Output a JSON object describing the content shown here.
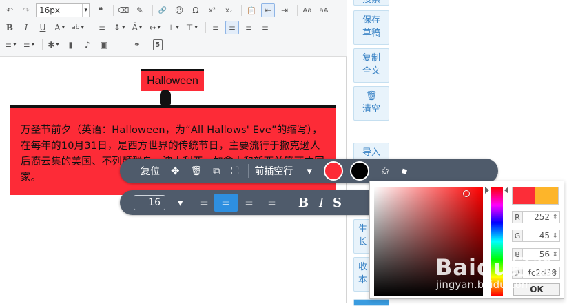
{
  "toolbar": {
    "font_size": "16px",
    "row1_icons": [
      "undo-icon",
      "redo-icon"
    ],
    "row1_after": [
      "quote-icon",
      "eraser-icon",
      "brush-icon",
      "link-icon",
      "emoji-icon",
      "omega-icon",
      "superscript-icon",
      "subscript-icon",
      "paste-icon",
      "indent-left-icon",
      "indent-right-icon",
      "font-up-icon",
      "font-down-icon"
    ],
    "glyphs": {
      "undo": "↶",
      "redo": "↷",
      "quote": "❝",
      "eraser": "⌫",
      "brush": "✎",
      "link": "🔗",
      "emoji": "☺",
      "omega": "Ω",
      "sup": "x²",
      "sub": "x₂",
      "paste": "📋",
      "indl": "⇤",
      "indr": "⇥",
      "fup": "Aa",
      "fdown": "aA",
      "bold": "B",
      "italic": "I",
      "underline": "U",
      "fontcolor": "A",
      "bgcolor": "ab",
      "ol": "≡",
      "lineheight": "↕",
      "case": "Ā",
      "spacing": "↔",
      "valign": "⊥",
      "halign": "⊤",
      "al": "≡",
      "ac": "≡",
      "ar": "≡",
      "aj": "≡",
      "ul": "≡",
      "magic": "✱",
      "col": "▮",
      "music": "♪",
      "image": "▣",
      "hr": "—",
      "binoculars": "⚭",
      "html5": "5"
    }
  },
  "content": {
    "title_box": "Halloween",
    "paragraph": "万圣节前夕（英语：Halloween，为“All Hallows' Eve”的缩写），在每年的10月31日，是西方世界的传统节日，主要流行于撒克逊人后裔云集的美国、不列颠群岛、澳大利亚、加拿大和新西兰等西方国家。"
  },
  "sidebar": {
    "buttons": [
      {
        "label": "搜索"
      },
      {
        "label": "保存草稿"
      },
      {
        "label": "复制全文"
      },
      {
        "label": "清空",
        "icon": "🗑"
      },
      {
        "label": "导入"
      },
      {
        "label": "生长"
      },
      {
        "label": "收本"
      }
    ]
  },
  "popup_top": {
    "reset": "复位",
    "move_icon": "✥",
    "delete_icon": "🗑",
    "copy_icon": "⧉",
    "fit_icon": "⛶",
    "insert_blank": "前插空行",
    "dropdown_icon": "▾",
    "color1": "#fd2b37",
    "color2": "#000000",
    "star_icon": "✩",
    "eraser_icon": "◆"
  },
  "popup_bottom": {
    "font_size_value": "16",
    "dropdown_icon": "▾",
    "bold": "B",
    "italic": "I",
    "strike": "S"
  },
  "picker": {
    "swatch_new": "#fc2d38",
    "swatch_old": "#fdb52a",
    "r_label": "R",
    "r_value": "252",
    "g_label": "G",
    "g_value": "45",
    "b_label": "B",
    "b_value": "56",
    "hex_label": "#",
    "hex_value": "fc2d38",
    "ok": "OK"
  },
  "watermark": {
    "text": "Baidu经验",
    "url": "jingyan.baidu.com"
  }
}
